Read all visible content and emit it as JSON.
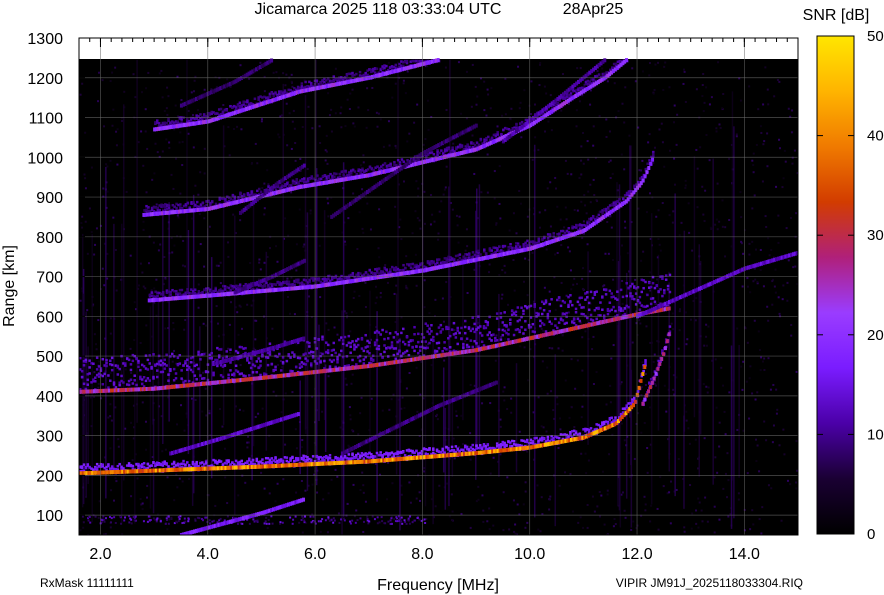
{
  "title": {
    "station_time": "Jicamarca 2025 118 03:33:04 UTC",
    "date": "28Apr25"
  },
  "colorbar": {
    "label": "SNR [dB]",
    "range": [
      0,
      50
    ],
    "ticks": [
      "0",
      "10",
      "20",
      "30",
      "40",
      "50"
    ],
    "colormap": [
      "#000000",
      "#1a0033",
      "#4b00a8",
      "#7a1cff",
      "#9a3cff",
      "#b0207a",
      "#d23c00",
      "#f07a00",
      "#ffb400",
      "#ffe600"
    ]
  },
  "footer": {
    "rxmask": "RxMask 11111111",
    "file": "VIPIR  JM91J_2025118033304.RIQ"
  },
  "chart_data": {
    "type": "heatmap",
    "title": "Jicamarca 2025 118 03:33:04 UTC",
    "xlabel": "Frequency [MHz]",
    "ylabel": "Range [km]",
    "xlim": [
      1.6,
      15.0
    ],
    "ylim": [
      50,
      1300
    ],
    "xticks": [
      "2.0",
      "4.0",
      "6.0",
      "8.0",
      "10.0",
      "12.0",
      "14.0"
    ],
    "yticks": [
      "100",
      "200",
      "300",
      "400",
      "500",
      "600",
      "700",
      "800",
      "900",
      "1000",
      "1100",
      "1200",
      "1300"
    ],
    "grid": true,
    "data_top_km": 1245,
    "traces": [
      {
        "id": "F-echo-1hop",
        "points": [
          [
            1.6,
            205
          ],
          [
            3,
            212
          ],
          [
            5,
            222
          ],
          [
            7,
            235
          ],
          [
            9,
            256
          ],
          [
            10,
            270
          ],
          [
            11,
            295
          ],
          [
            11.6,
            330
          ],
          [
            11.95,
            380
          ],
          [
            12.05,
            430
          ],
          [
            12.15,
            480
          ]
        ],
        "snr": 42
      },
      {
        "id": "F-echo-1hop-x",
        "points": [
          [
            12.1,
            380
          ],
          [
            12.3,
            440
          ],
          [
            12.5,
            510
          ],
          [
            12.6,
            560
          ]
        ],
        "snr": 28
      },
      {
        "id": "F-echo-2hop",
        "points": [
          [
            1.6,
            410
          ],
          [
            3,
            418
          ],
          [
            5,
            445
          ],
          [
            7,
            475
          ],
          [
            9,
            515
          ],
          [
            10,
            545
          ],
          [
            11,
            575
          ],
          [
            12,
            605
          ],
          [
            12.6,
            620
          ]
        ],
        "snr": 30
      },
      {
        "id": "F-echo-2hop-x",
        "points": [
          [
            12,
            600
          ],
          [
            13,
            660
          ],
          [
            14,
            720
          ],
          [
            15,
            760
          ]
        ],
        "snr": 14
      },
      {
        "id": "F-echo-3hop",
        "points": [
          [
            2.9,
            640
          ],
          [
            4,
            652
          ],
          [
            6,
            675
          ],
          [
            8,
            715
          ],
          [
            10,
            770
          ],
          [
            11,
            815
          ],
          [
            11.8,
            890
          ],
          [
            12.1,
            940
          ],
          [
            12.3,
            1000
          ]
        ],
        "snr": 22
      },
      {
        "id": "F-echo-4hop",
        "points": [
          [
            2.8,
            855
          ],
          [
            4,
            870
          ],
          [
            5.7,
            925
          ],
          [
            7,
            955
          ],
          [
            9,
            1020
          ],
          [
            10,
            1080
          ],
          [
            10.8,
            1150
          ],
          [
            11.4,
            1200
          ],
          [
            11.8,
            1245
          ]
        ],
        "snr": 22
      },
      {
        "id": "F-echo-5hop",
        "points": [
          [
            3,
            1070
          ],
          [
            4,
            1090
          ],
          [
            5.7,
            1165
          ],
          [
            7,
            1200
          ],
          [
            8.3,
            1245
          ]
        ],
        "snr": 22
      },
      {
        "id": "E-layer-obl-1",
        "points": [
          [
            3.5,
            50
          ],
          [
            5,
            105
          ],
          [
            5.8,
            140
          ]
        ],
        "snr": 18
      },
      {
        "id": "E-layer-obl-2",
        "points": [
          [
            3.3,
            255
          ],
          [
            4.3,
            295
          ],
          [
            5.7,
            355
          ]
        ],
        "snr": 14
      },
      {
        "id": "E-layer-obl-3",
        "points": [
          [
            4.1,
            480
          ],
          [
            5.2,
            520
          ],
          [
            5.8,
            545
          ]
        ],
        "snr": 12
      },
      {
        "id": "E-layer-obl-4",
        "points": [
          [
            4.5,
            660
          ],
          [
            5.2,
            700
          ],
          [
            5.8,
            740
          ]
        ],
        "snr": 10
      },
      {
        "id": "E-layer-obl-5",
        "points": [
          [
            4.6,
            860
          ],
          [
            5.3,
            935
          ],
          [
            5.8,
            980
          ]
        ],
        "snr": 10
      },
      {
        "id": "E-layer-obl-6",
        "points": [
          [
            3.5,
            1130
          ],
          [
            4.5,
            1190
          ],
          [
            5.2,
            1245
          ]
        ],
        "snr": 9
      },
      {
        "id": "oblique-7",
        "points": [
          [
            6.5,
            255
          ],
          [
            8.3,
            375
          ],
          [
            9.4,
            435
          ]
        ],
        "snr": 10
      },
      {
        "id": "oblique-8",
        "points": [
          [
            6.3,
            850
          ],
          [
            8,
            1010
          ],
          [
            9,
            1080
          ]
        ],
        "snr": 9
      },
      {
        "id": "oblique-9",
        "points": [
          [
            9.5,
            1040
          ],
          [
            10.5,
            1145
          ],
          [
            11.4,
            1245
          ]
        ],
        "snr": 12
      }
    ],
    "noise_band_km": [
      [
        80,
        100
      ]
    ]
  }
}
